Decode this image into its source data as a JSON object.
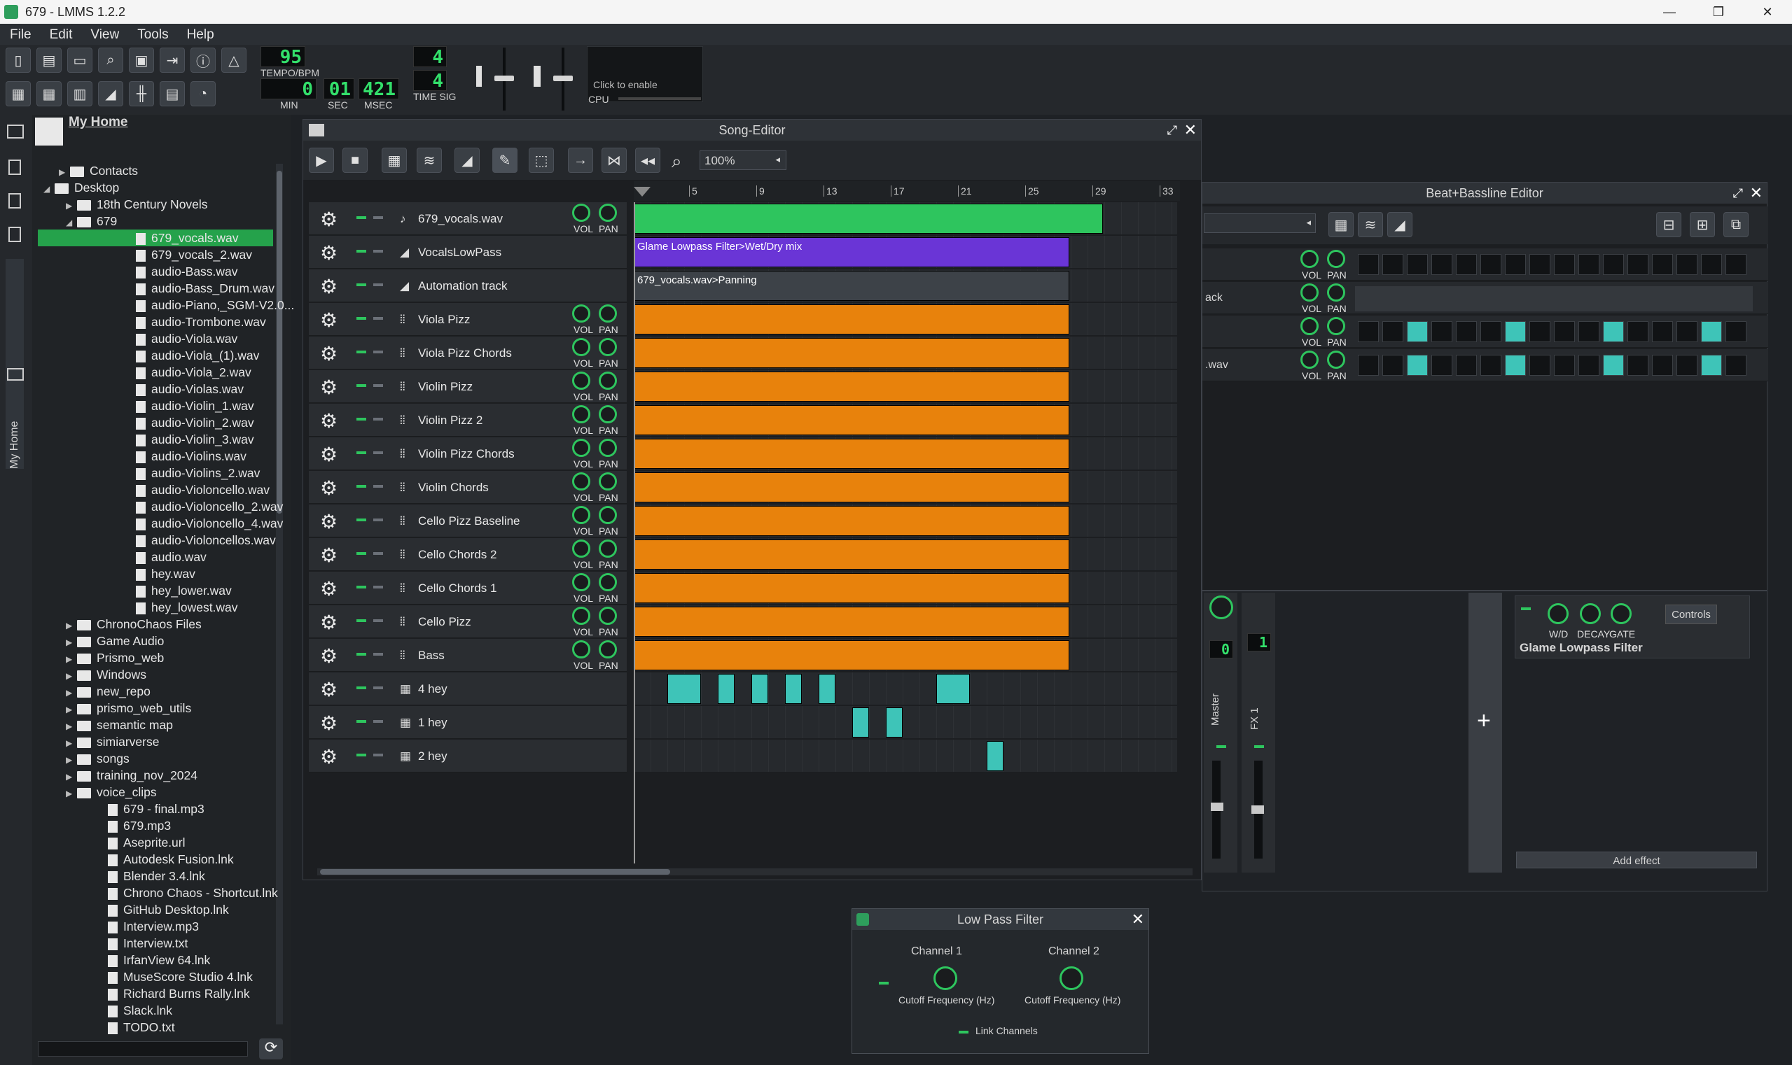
{
  "window": {
    "title": "679 - LMMS 1.2.2",
    "controls": [
      "—",
      "❐",
      "✕"
    ]
  },
  "menu": [
    "File",
    "Edit",
    "View",
    "Tools",
    "Help"
  ],
  "transport": {
    "tempo": "95",
    "tempo_label": "TEMPO/BPM",
    "min": "0",
    "sec": "01",
    "msec": "421",
    "min_label": "MIN",
    "sec_label": "SEC",
    "msec_label": "MSEC",
    "ts_num": "4",
    "ts_den": "4",
    "ts_label": "TIME SIG",
    "cpu_hint": "Click to enable",
    "cpu_label": "CPU"
  },
  "browser": {
    "title": "My Home",
    "tab_label": "My Home",
    "items": [
      {
        "name": "Contacts",
        "type": "folder",
        "depth": 1,
        "arrow": "▶"
      },
      {
        "name": "Desktop",
        "type": "folder",
        "depth": 0,
        "arrow": "◢"
      },
      {
        "name": "18th Century Novels",
        "type": "folder",
        "depth": 2,
        "arrow": "▶"
      },
      {
        "name": "679",
        "type": "folder",
        "depth": 2,
        "arrow": "◢"
      },
      {
        "name": "679_vocals.wav",
        "type": "file",
        "depth": 3,
        "selected": true
      },
      {
        "name": "679_vocals_2.wav",
        "type": "file",
        "depth": 3
      },
      {
        "name": "audio-Bass.wav",
        "type": "file",
        "depth": 3
      },
      {
        "name": "audio-Bass_Drum.wav",
        "type": "file",
        "depth": 3
      },
      {
        "name": "audio-Piano,_SGM-V2.0...",
        "type": "file",
        "depth": 3
      },
      {
        "name": "audio-Trombone.wav",
        "type": "file",
        "depth": 3
      },
      {
        "name": "audio-Viola.wav",
        "type": "file",
        "depth": 3
      },
      {
        "name": "audio-Viola_(1).wav",
        "type": "file",
        "depth": 3
      },
      {
        "name": "audio-Viola_2.wav",
        "type": "file",
        "depth": 3
      },
      {
        "name": "audio-Violas.wav",
        "type": "file",
        "depth": 3
      },
      {
        "name": "audio-Violin_1.wav",
        "type": "file",
        "depth": 3
      },
      {
        "name": "audio-Violin_2.wav",
        "type": "file",
        "depth": 3
      },
      {
        "name": "audio-Violin_3.wav",
        "type": "file",
        "depth": 3
      },
      {
        "name": "audio-Violins.wav",
        "type": "file",
        "depth": 3
      },
      {
        "name": "audio-Violins_2.wav",
        "type": "file",
        "depth": 3
      },
      {
        "name": "audio-Violoncello.wav",
        "type": "file",
        "depth": 3
      },
      {
        "name": "audio-Violoncello_2.wav",
        "type": "file",
        "depth": 3
      },
      {
        "name": "audio-Violoncello_4.wav",
        "type": "file",
        "depth": 3
      },
      {
        "name": "audio-Violoncellos.wav",
        "type": "file",
        "depth": 3
      },
      {
        "name": "audio.wav",
        "type": "file",
        "depth": 3
      },
      {
        "name": "hey.wav",
        "type": "file",
        "depth": 3
      },
      {
        "name": "hey_lower.wav",
        "type": "file",
        "depth": 3
      },
      {
        "name": "hey_lowest.wav",
        "type": "file",
        "depth": 3
      },
      {
        "name": "ChronoChaos Files",
        "type": "folder",
        "depth": 2,
        "arrow": "▶"
      },
      {
        "name": "Game Audio",
        "type": "folder",
        "depth": 2,
        "arrow": "▶"
      },
      {
        "name": "Prismo_web",
        "type": "folder",
        "depth": 2,
        "arrow": "▶"
      },
      {
        "name": "Windows",
        "type": "folder",
        "depth": 2,
        "arrow": "▶"
      },
      {
        "name": "new_repo",
        "type": "folder",
        "depth": 2,
        "arrow": "▶"
      },
      {
        "name": "prismo_web_utils",
        "type": "folder",
        "depth": 2,
        "arrow": "▶"
      },
      {
        "name": "semantic map",
        "type": "folder",
        "depth": 2,
        "arrow": "▶"
      },
      {
        "name": "simiarverse",
        "type": "folder",
        "depth": 2,
        "arrow": "▶"
      },
      {
        "name": "songs",
        "type": "folder",
        "depth": 2,
        "arrow": "▶"
      },
      {
        "name": "training_nov_2024",
        "type": "folder",
        "depth": 2,
        "arrow": "▶"
      },
      {
        "name": "voice_clips",
        "type": "folder",
        "depth": 2,
        "arrow": "▶"
      },
      {
        "name": "679 - final.mp3",
        "type": "file",
        "depth": 2
      },
      {
        "name": "679.mp3",
        "type": "file",
        "depth": 2
      },
      {
        "name": "Aseprite.url",
        "type": "file",
        "depth": 2
      },
      {
        "name": "Autodesk Fusion.lnk",
        "type": "file",
        "depth": 2
      },
      {
        "name": "Blender 3.4.lnk",
        "type": "file",
        "depth": 2
      },
      {
        "name": "Chrono Chaos - Shortcut.lnk",
        "type": "file",
        "depth": 2
      },
      {
        "name": "GitHub Desktop.lnk",
        "type": "file",
        "depth": 2
      },
      {
        "name": "Interview.mp3",
        "type": "file",
        "depth": 2
      },
      {
        "name": "Interview.txt",
        "type": "file",
        "depth": 2
      },
      {
        "name": "IrfanView 64.lnk",
        "type": "file",
        "depth": 2
      },
      {
        "name": "MuseScore Studio 4.lnk",
        "type": "file",
        "depth": 2
      },
      {
        "name": "Richard Burns Rally.lnk",
        "type": "file",
        "depth": 2
      },
      {
        "name": "Slack.lnk",
        "type": "file",
        "depth": 2
      },
      {
        "name": "TODO.txt",
        "type": "file",
        "depth": 2
      }
    ]
  },
  "song_editor": {
    "title": "Song-Editor",
    "zoom": "100%",
    "bars": [
      "5",
      "9",
      "13",
      "17",
      "21",
      "25",
      "29",
      "33"
    ],
    "tracks": [
      {
        "name": "679_vocals.wav",
        "kind": "sample",
        "knobs": true,
        "clip_color": "#2ec55e"
      },
      {
        "name": "VocalsLowPass",
        "kind": "automation",
        "knobs": false,
        "clip_label": "Glame Lowpass Filter>Wet/Dry mix",
        "clip_color": "#6a35d6"
      },
      {
        "name": "Automation track",
        "kind": "automation",
        "knobs": false,
        "clip_label": "679_vocals.wav>Panning",
        "clip_color": "#3d4248"
      },
      {
        "name": "Viola Pizz",
        "kind": "instrument",
        "knobs": true,
        "clip_color": "#e8820c"
      },
      {
        "name": "Viola Pizz Chords",
        "kind": "instrument",
        "knobs": true,
        "clip_color": "#e8820c"
      },
      {
        "name": "Violin Pizz",
        "kind": "instrument",
        "knobs": true,
        "clip_color": "#e8820c"
      },
      {
        "name": "Violin Pizz 2",
        "kind": "instrument",
        "knobs": true,
        "clip_color": "#e8820c"
      },
      {
        "name": "Violin Pizz Chords",
        "kind": "instrument",
        "knobs": true,
        "clip_color": "#e8820c"
      },
      {
        "name": "Violin Chords",
        "kind": "instrument",
        "knobs": true,
        "clip_color": "#e8820c"
      },
      {
        "name": "Cello Pizz Baseline",
        "kind": "instrument",
        "knobs": true,
        "clip_color": "#e8820c"
      },
      {
        "name": "Cello Chords 2",
        "kind": "instrument",
        "knobs": true,
        "clip_color": "#e8820c"
      },
      {
        "name": "Cello Chords 1",
        "kind": "instrument",
        "knobs": true,
        "clip_color": "#e8820c"
      },
      {
        "name": "Cello Pizz",
        "kind": "instrument",
        "knobs": true,
        "clip_color": "#e8820c"
      },
      {
        "name": "Bass",
        "kind": "instrument",
        "knobs": true,
        "clip_color": "#e8820c"
      },
      {
        "name": "4 hey",
        "kind": "beat",
        "knobs": false
      },
      {
        "name": "1 hey",
        "kind": "beat",
        "knobs": false
      },
      {
        "name": "2 hey",
        "kind": "beat",
        "knobs": false
      }
    ],
    "vol_label": "VOL",
    "pan_label": "PAN"
  },
  "bb_editor": {
    "title": "Beat+Bassline Editor",
    "row_labels": [
      "",
      "ack",
      "",
      ".wav"
    ],
    "steps": [
      [
        0,
        0,
        0,
        0,
        0,
        0,
        0,
        0,
        0,
        0,
        0,
        0,
        0,
        0,
        0,
        0
      ],
      [],
      [
        0,
        0,
        1,
        0,
        0,
        0,
        1,
        0,
        0,
        0,
        1,
        0,
        0,
        0,
        1,
        0
      ],
      [
        0,
        0,
        1,
        0,
        0,
        0,
        1,
        0,
        0,
        0,
        1,
        0,
        0,
        0,
        1,
        0
      ]
    ]
  },
  "mixer": {
    "master": "Master",
    "fx1": "FX 1",
    "lcd": "0",
    "fx_lcd": "1",
    "add": "+"
  },
  "effects": {
    "wd": "W/D",
    "decay": "DECAY",
    "gate": "GATE",
    "controls": "Controls",
    "name": "Glame Lowpass Filter",
    "add_effect": "Add effect"
  },
  "lpf": {
    "title": "Low Pass Filter",
    "ch1": "Channel 1",
    "ch2": "Channel 2",
    "cutoff": "Cutoff Frequency (Hz)",
    "link": "Link Channels"
  },
  "colors": {
    "accent": "#2ec55e",
    "selected": "#25a24b",
    "step_on": "#3ec4b8"
  }
}
